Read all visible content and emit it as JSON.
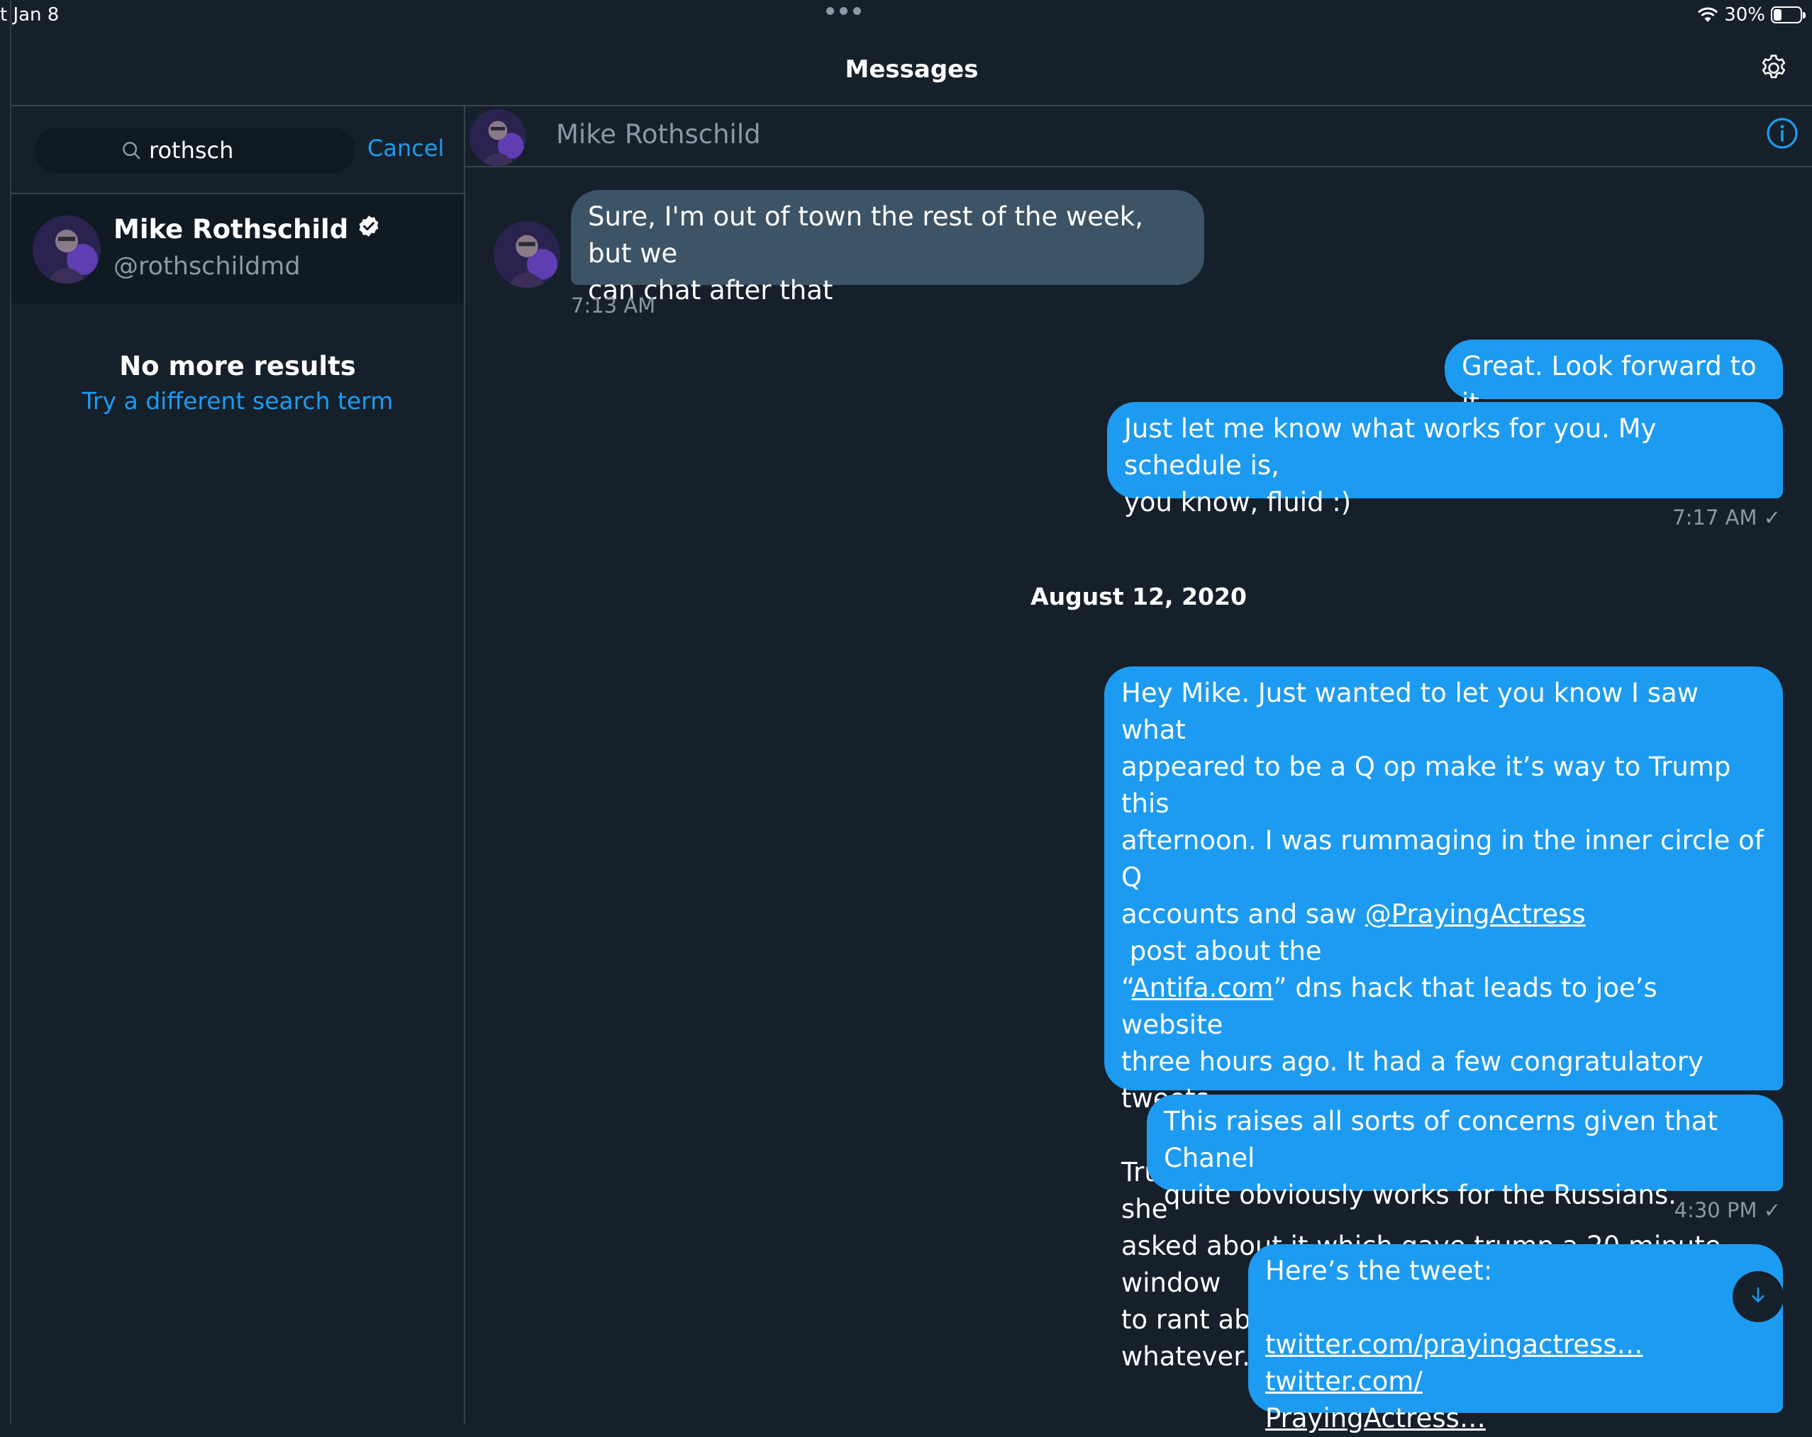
{
  "status_bar": {
    "time": "t Jan 8",
    "battery": "30%",
    "battery_level": 0.3
  },
  "nav": {
    "title": "Messages"
  },
  "search": {
    "value": "rothsch",
    "cancel_label": "Cancel"
  },
  "result": {
    "name": "Mike Rothschild",
    "handle": "@rothschildmd"
  },
  "no_results": {
    "title": "No more results",
    "subtitle": "Try a different search term"
  },
  "conversation": {
    "header_name": "Mike Rothschild",
    "messages": [
      {
        "from": "them",
        "lines": [
          "Sure, I'm out of town the rest of the week, but we",
          "can chat after that"
        ],
        "time": "7:13 AM"
      },
      {
        "from": "me",
        "lines": [
          "Great. Look forward to it."
        ]
      },
      {
        "from": "me",
        "lines": [
          "Just let me know what works for you. My schedule is,",
          "you know, fluid :)"
        ],
        "time": "7:17 AM ✓"
      },
      {
        "from": "me",
        "lines": [
          "Hey Mike. Just wanted to let you know I saw what",
          "appeared to be a Q op make it’s way to Trump this",
          "afternoon. I was rummaging in the inner circle of Q",
          "three hours ago. It had a few congratulatory tweets.",
          "Trump called on Chanel from OANN again and she",
          "asked about it which gave trump a 20 minute window",
          "to rant about joe being an Antifa super soldier or",
          "whatever. Fox cut away right after."
        ],
        "line4_pre": "accounts and saw ",
        "line4_link": "@PrayingActress",
        "line4_post": " post about the",
        "line5_pre": "“",
        "line5_link": "Antifa.com",
        "line5_post": "” dns hack that leads to joe’s website"
      },
      {
        "from": "me",
        "lines": [
          "This raises all sorts of concerns given that Chanel",
          "quite obviously works for the Russians."
        ],
        "time": "4:30 PM ✓"
      },
      {
        "from": "me",
        "lines": [
          "Here’s the tweet:"
        ],
        "links": [
          "twitter.com/prayingactress…",
          "twitter.com/",
          "PrayingActress…"
        ]
      }
    ],
    "date_separator": "August 12, 2020"
  },
  "icons": {
    "search": "search-icon",
    "gear": "gear-icon",
    "info": "info-icon",
    "verified": "verified-badge-icon",
    "wifi": "wifi-icon",
    "battery": "battery-icon",
    "scroll_down": "arrow-down-icon"
  },
  "colors": {
    "background": "#15202b",
    "accent": "#1d9bf0",
    "incoming_bubble": "#3d5466",
    "secondary_text": "#8b98a5"
  }
}
